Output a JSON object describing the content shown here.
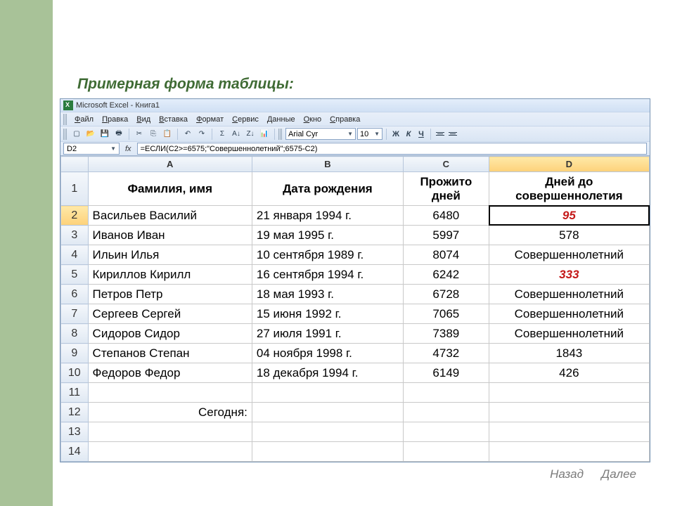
{
  "slide_title": "Примерная форма таблицы:",
  "window_title": "Microsoft Excel - Книга1",
  "menu": [
    "Файл",
    "Правка",
    "Вид",
    "Вставка",
    "Формат",
    "Сервис",
    "Данные",
    "Окно",
    "Справка"
  ],
  "font_name": "Arial Cyr",
  "font_size": "10",
  "bold_label": "Ж",
  "italic_label": "К",
  "underline_label": "Ч",
  "name_box": "D2",
  "fx": "fx",
  "formula": "=ЕСЛИ(C2>=6575;\"Совершеннолетний\";6575-C2)",
  "columns": [
    "A",
    "B",
    "C",
    "D"
  ],
  "header_row": {
    "num": "1",
    "a": "Фамилия, имя",
    "b": "Дата рождения",
    "c": "Прожито дней",
    "d": "Дней до совершеннолетия"
  },
  "rows": [
    {
      "num": "2",
      "a": "Васильев Василий",
      "b": "21 января 1994 г.",
      "c": "6480",
      "d": "95",
      "d_red": true,
      "active": true
    },
    {
      "num": "3",
      "a": "Иванов Иван",
      "b": "19 мая 1995 г.",
      "c": "5997",
      "d": "578"
    },
    {
      "num": "4",
      "a": "Ильин Илья",
      "b": "10 сентября 1989 г.",
      "c": "8074",
      "d": "Совершеннолетний"
    },
    {
      "num": "5",
      "a": "Кириллов Кирилл",
      "b": "16 сентября 1994 г.",
      "c": "6242",
      "d": "333",
      "d_red": true
    },
    {
      "num": "6",
      "a": "Петров Петр",
      "b": "18 мая 1993 г.",
      "c": "6728",
      "d": "Совершеннолетний"
    },
    {
      "num": "7",
      "a": "Сергеев Сергей",
      "b": "15 июня 1992 г.",
      "c": "7065",
      "d": "Совершеннолетний"
    },
    {
      "num": "8",
      "a": "Сидоров Сидор",
      "b": "27 июля 1991 г.",
      "c": "7389",
      "d": "Совершеннолетний"
    },
    {
      "num": "9",
      "a": "Степанов Степан",
      "b": "04 ноября 1998 г.",
      "c": "4732",
      "d": "1843"
    },
    {
      "num": "10",
      "a": "Федоров Федор",
      "b": "18 декабря 1994 г.",
      "c": "6149",
      "d": "426"
    }
  ],
  "blank_rows": [
    "11"
  ],
  "today_row": {
    "num": "12",
    "label": "Сегодня:"
  },
  "trailing_rows": [
    "13",
    "14"
  ],
  "nav_back": "Назад",
  "nav_next": "Далее"
}
